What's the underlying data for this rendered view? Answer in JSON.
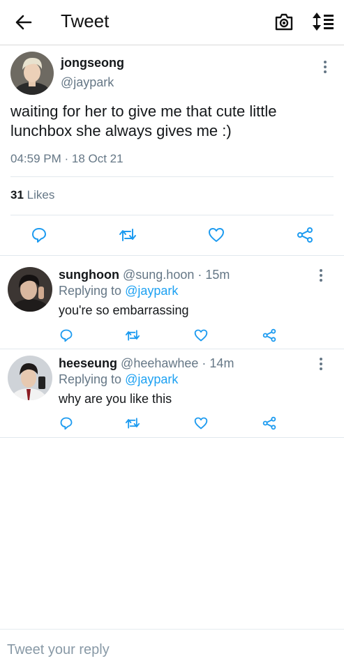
{
  "header": {
    "title": "Tweet"
  },
  "tweet": {
    "name": "jongseong",
    "handle": "@jaypark",
    "text": "waiting for her to give me that cute little lunchbox she always gives me :)",
    "time": "04:59 PM · 18 Oct 21",
    "likes_count": "31",
    "likes_label": " Likes"
  },
  "replies": [
    {
      "name": "sunghoon",
      "handle": "@sung.hoon",
      "time": "· 15m",
      "replying_prefix": "Replying to ",
      "replying_to": "@jaypark",
      "text": "you're so embarrassing"
    },
    {
      "name": "heeseung",
      "handle": "@heehawhee",
      "time": "· 14m",
      "replying_prefix": "Replying to ",
      "replying_to": "@jaypark",
      "text": "why are you like this"
    }
  ],
  "compose": {
    "placeholder": "Tweet your reply"
  },
  "icons": {
    "back": "arrow-left-icon",
    "camera": "camera-icon",
    "sort": "sort-icon",
    "more": "more-vertical-icon",
    "reply": "reply-icon",
    "retweet": "retweet-icon",
    "like": "heart-icon",
    "share": "share-icon"
  },
  "colors": {
    "link": "#1da1f2",
    "secondary_text": "#657786",
    "icon": "#1d9bf0"
  }
}
